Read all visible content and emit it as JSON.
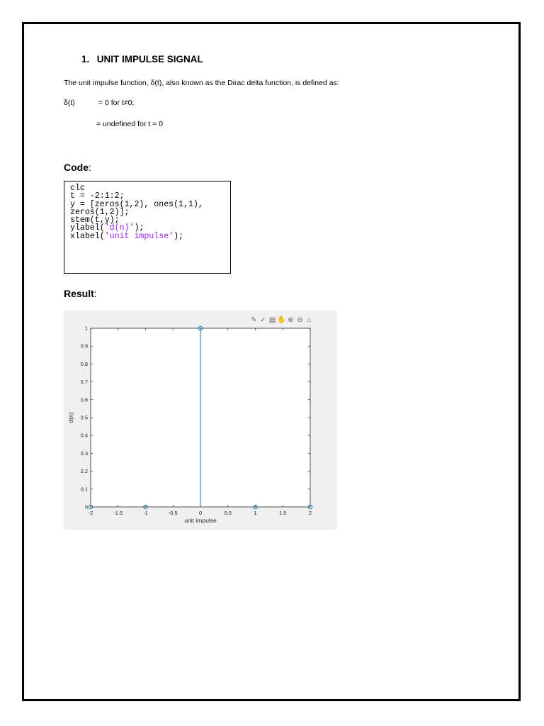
{
  "heading": {
    "number": "1.",
    "title": "UNIT IMPULSE SIGNAL"
  },
  "intro": "The unit impulse function, δ(t), also known as the Dirac delta function, is defined as:",
  "definition": {
    "lhs": "δ(t)",
    "case1": "= 0 for t≠0;",
    "case2": "= undefined for t = 0"
  },
  "code_section": {
    "label": "Code",
    "colon": ":"
  },
  "code": {
    "lines": [
      {
        "plain": "clc"
      },
      {
        "plain": "t = -2:1:2;"
      },
      {
        "plain": "y = [zeros(1,2), ones(1,1),"
      },
      {
        "plain": "zeros(1,2)];"
      },
      {
        "plain": "stem(t,y);"
      },
      {
        "pre": "ylabel(",
        "str": "'d(n)'",
        "post": ");"
      },
      {
        "pre": "xlabel(",
        "str": "'unit impulse'",
        "post": ");"
      }
    ]
  },
  "result_section": {
    "label": "Result",
    "colon": ":"
  },
  "toolbar_icons": [
    "brush-export-icon",
    "brush-icon",
    "data-tip-icon",
    "pan-icon",
    "zoom-in-icon",
    "zoom-out-icon",
    "home-icon"
  ],
  "chart_data": {
    "type": "stem",
    "x": [
      -2,
      -1,
      0,
      1,
      2
    ],
    "y": [
      0,
      0,
      1,
      0,
      0
    ],
    "xlabel": "unit impulse",
    "ylabel": "d(n)",
    "xlim": [
      -2,
      2
    ],
    "ylim": [
      0,
      1
    ],
    "xticks": [
      "-2",
      "-1.5",
      "-1",
      "-0.5",
      "0",
      "0.5",
      "1",
      "1.5",
      "2"
    ],
    "yticks": [
      "0",
      "0.1",
      "0.2",
      "0.3",
      "0.4",
      "0.5",
      "0.6",
      "0.7",
      "0.8",
      "0.9",
      "1"
    ],
    "grid": false,
    "color": "#0072bd"
  }
}
